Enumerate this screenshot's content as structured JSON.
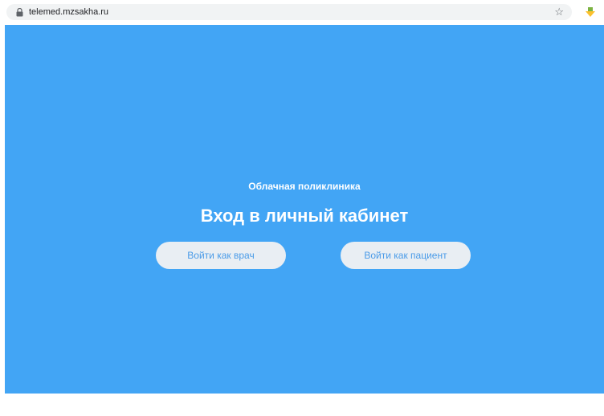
{
  "browser": {
    "url": "telemed.mzsakha.ru",
    "icons": {
      "lock": "lock-icon",
      "bookmark": "star-icon",
      "extension": "download-arrow-icon"
    }
  },
  "main": {
    "subtitle": "Облачная поликлиника",
    "title": "Вход в личный кабинет",
    "buttons": {
      "doctor": "Войти как врач",
      "patient": "Войти как пациент"
    }
  },
  "colors": {
    "background": "#42a5f5",
    "button_bg": "#e9eef3",
    "button_text": "#4a9be8",
    "heading_text": "#ffffff"
  }
}
